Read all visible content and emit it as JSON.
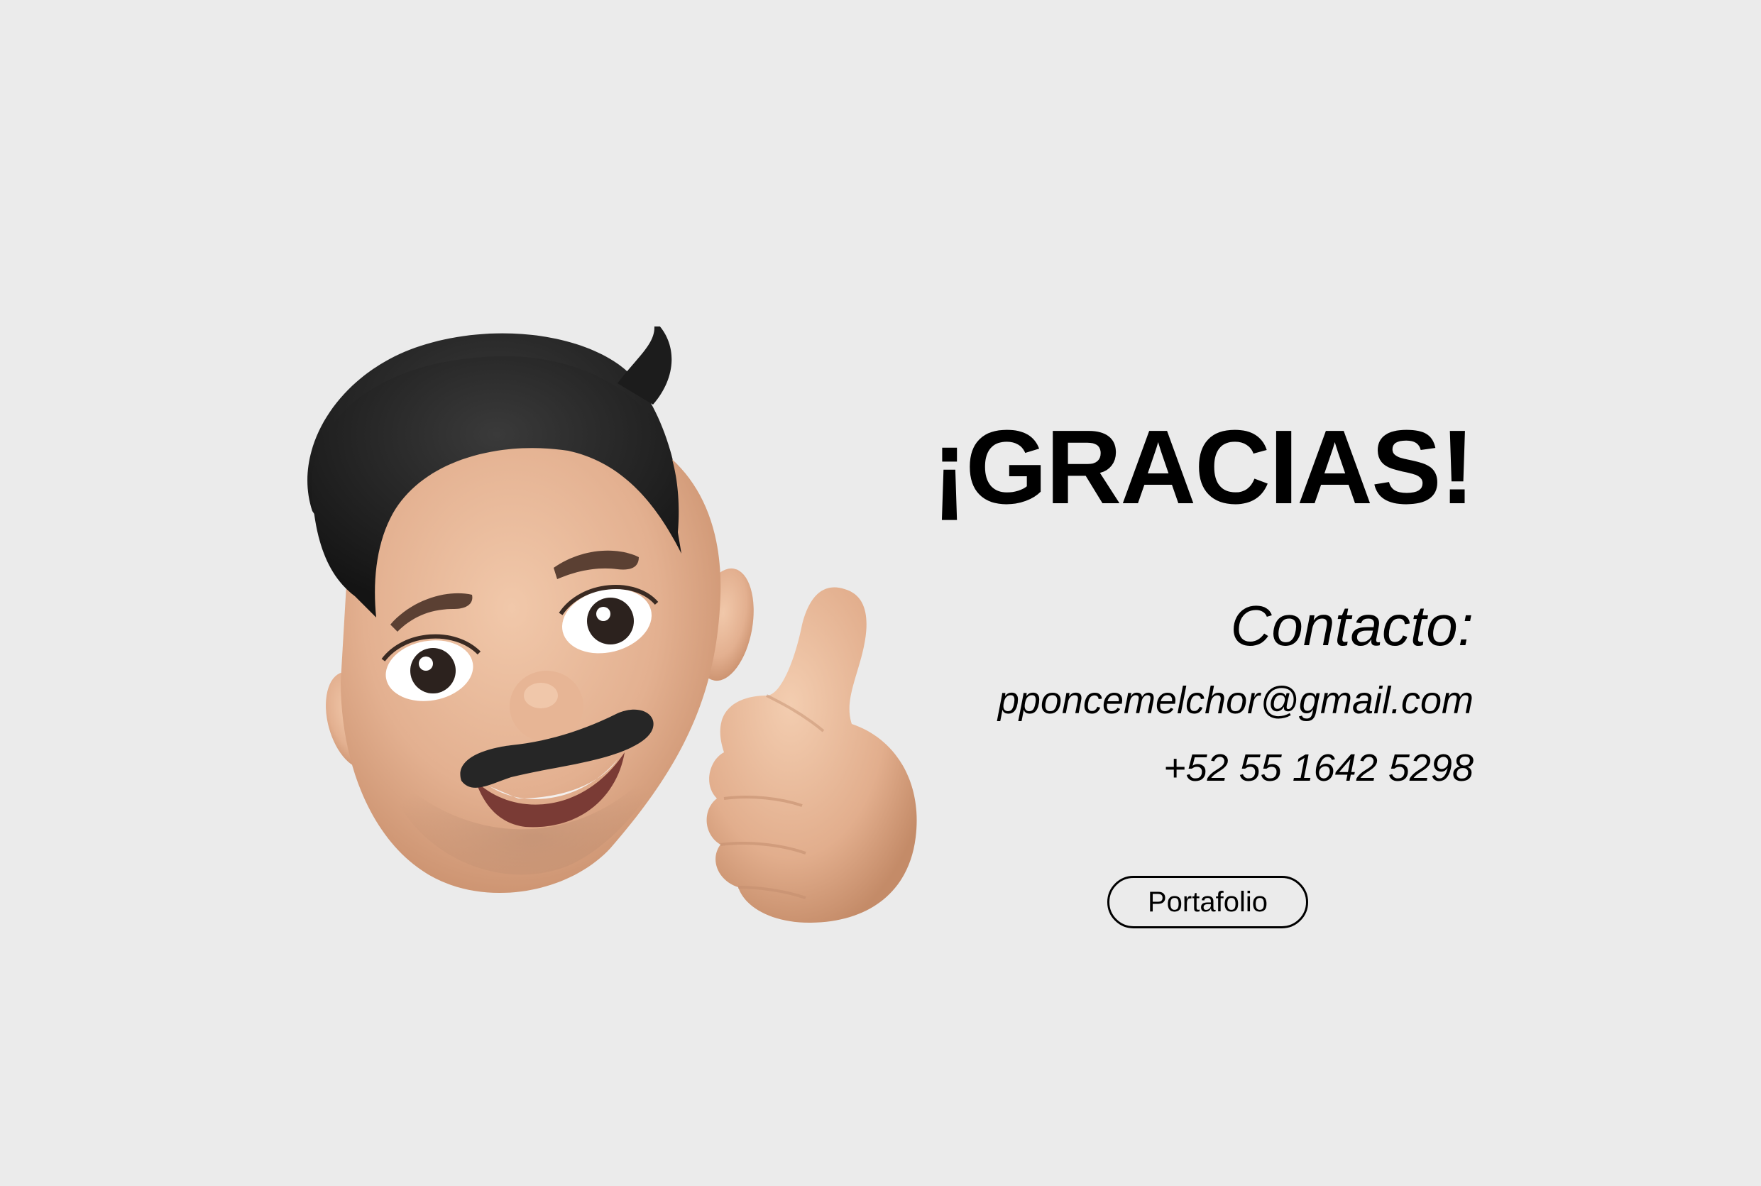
{
  "title": "¡GRACIAS!",
  "contact": {
    "label": "Contacto:",
    "email": "pponcemelchor@gmail.com",
    "phone": "+52 55 1642 5298"
  },
  "portfolio_button": {
    "label": "Portafolio"
  },
  "avatar": {
    "icon": "memoji-thumbs-up-icon"
  },
  "colors": {
    "background": "#ebebeb",
    "text": "#000000",
    "skin": "#e3b292",
    "hair": "#1e1e1e"
  }
}
